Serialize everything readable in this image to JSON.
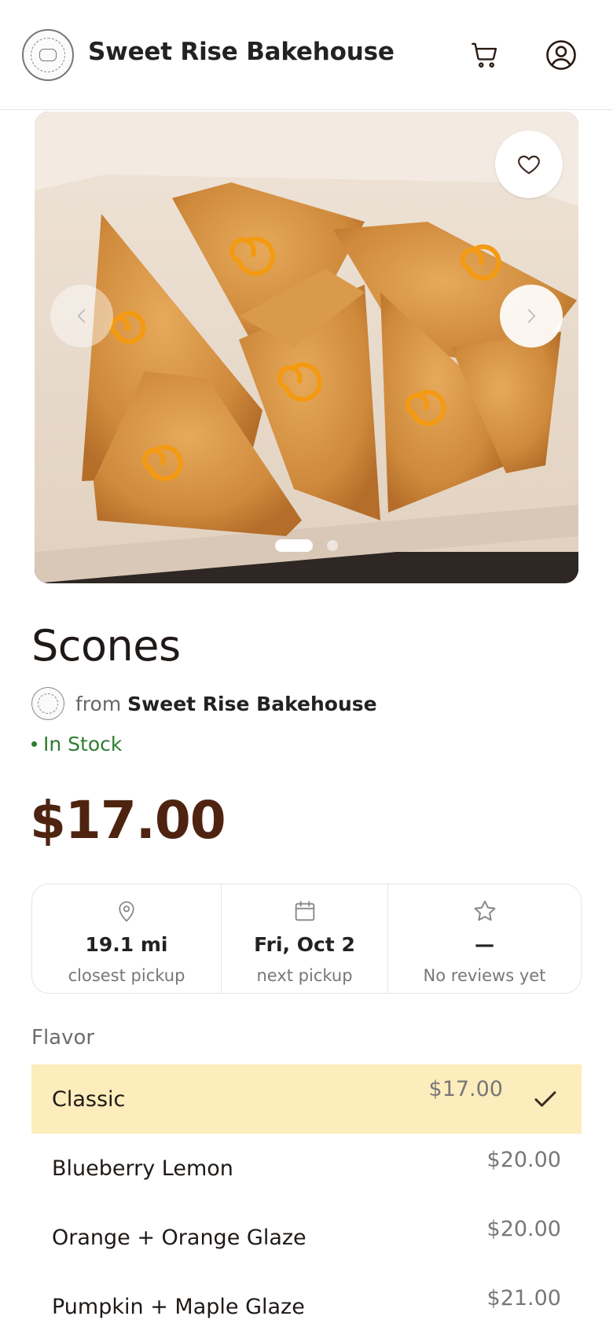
{
  "header": {
    "brand_name": "Sweet Rise Bakehouse",
    "logo_icon": "bakery-seal-icon",
    "cart_icon": "cart-icon",
    "account_icon": "user-circle-icon"
  },
  "gallery": {
    "image_alt": "Box of orange-glazed scones",
    "image_count": 2,
    "active_index": 0,
    "favorite_icon": "heart-icon",
    "prev_icon": "chevron-left-icon",
    "next_icon": "chevron-right-icon"
  },
  "product": {
    "title": "Scones",
    "from_text": "from",
    "seller_name": "Sweet Rise Bakehouse",
    "stock_status": "In Stock",
    "price": "$17.00"
  },
  "stats": [
    {
      "icon": "map-pin-icon",
      "value": "19.1 mi",
      "label": "closest pickup"
    },
    {
      "icon": "calendar-icon",
      "value": "Fri, Oct 2",
      "label": "next pickup"
    },
    {
      "icon": "star-icon",
      "value": "—",
      "label": "No reviews yet"
    }
  ],
  "flavor": {
    "label": "Flavor",
    "options": [
      {
        "name": "Classic",
        "price": "$17.00",
        "selected": true
      },
      {
        "name": "Blueberry Lemon",
        "price": "$20.00",
        "selected": false
      },
      {
        "name": "Orange + Orange Glaze",
        "price": "$20.00",
        "selected": false
      },
      {
        "name": "Pumpkin + Maple Glaze",
        "price": "$21.00",
        "selected": false
      }
    ]
  },
  "colors": {
    "price": "#4e2410",
    "in_stock": "#2e7d32",
    "selected_bg": "#fdecbc"
  }
}
